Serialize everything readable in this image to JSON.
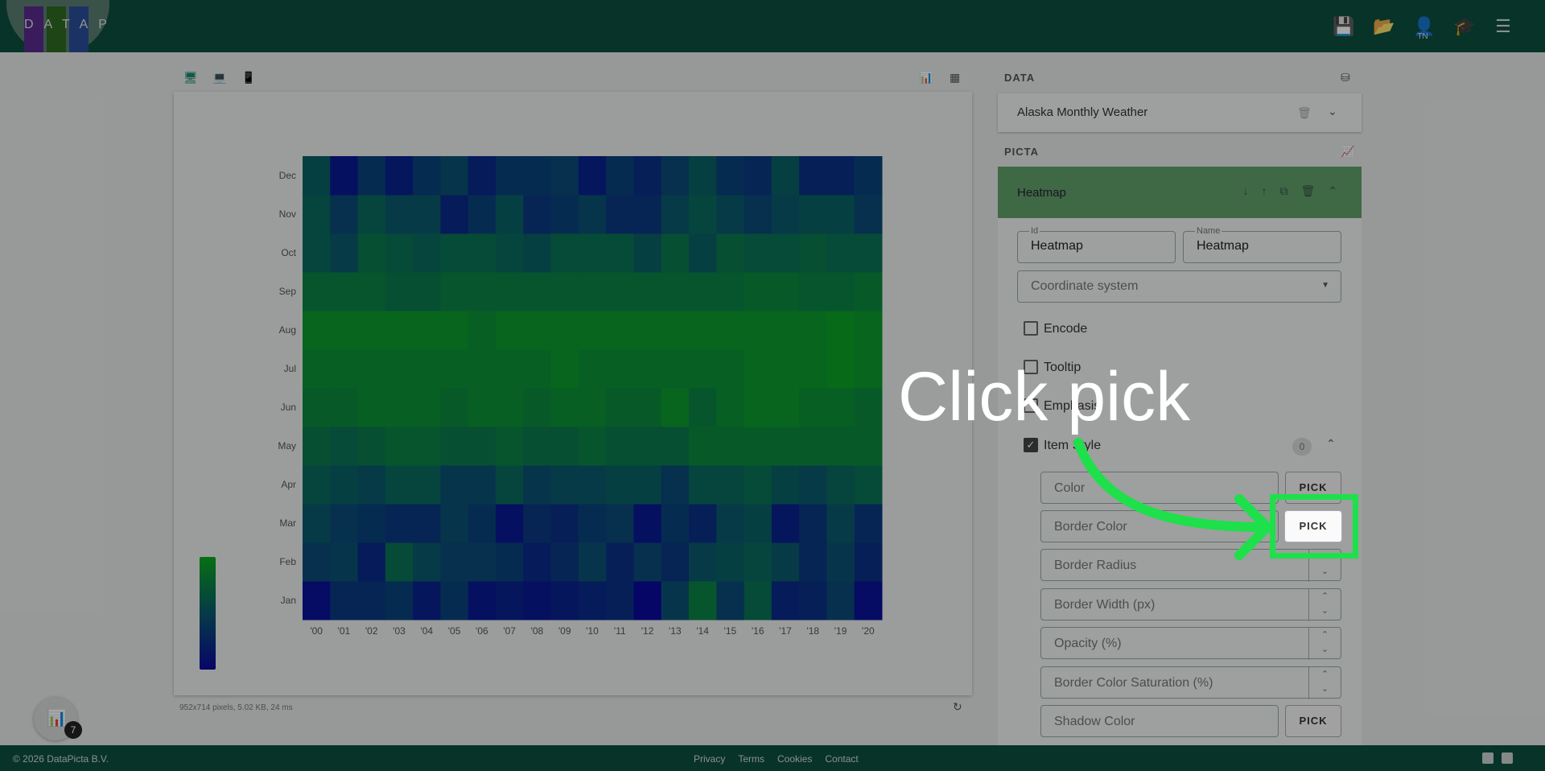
{
  "app": {
    "brand": "DATAPICTA"
  },
  "toolbar": {
    "icons": [
      "save-icon",
      "folder-open-icon",
      "user-icon",
      "school-icon",
      "menu-icon"
    ],
    "user_initials": "TN"
  },
  "preview": {
    "device_icons": [
      "desktop-icon",
      "laptop-icon",
      "phone-icon"
    ],
    "view_icons": [
      "chart-icon",
      "table-icon"
    ],
    "stats": "952x714 pixels, 5.02 KB, 24 ms"
  },
  "chart_data": {
    "type": "heatmap",
    "x_categories": [
      "'00",
      "'01",
      "'02",
      "'03",
      "'04",
      "'05",
      "'06",
      "'07",
      "'08",
      "'09",
      "'10",
      "'11",
      "'12",
      "'13",
      "'14",
      "'15",
      "'16",
      "'17",
      "'18",
      "'19",
      "'20"
    ],
    "y_categories": [
      "Jan",
      "Feb",
      "Mar",
      "Apr",
      "May",
      "Jun",
      "Jul",
      "Aug",
      "Sep",
      "Oct",
      "Nov",
      "Dec"
    ],
    "values": [
      [
        0.05,
        0.3,
        0.3,
        0.35,
        0.15,
        0.35,
        0.1,
        0.15,
        0.1,
        0.15,
        0.2,
        0.25,
        0.0,
        0.45,
        0.75,
        0.4,
        0.65,
        0.2,
        0.25,
        0.4,
        0.05
      ],
      [
        0.4,
        0.45,
        0.2,
        0.65,
        0.5,
        0.4,
        0.4,
        0.35,
        0.2,
        0.3,
        0.45,
        0.25,
        0.4,
        0.3,
        0.5,
        0.55,
        0.6,
        0.5,
        0.3,
        0.45,
        0.25
      ],
      [
        0.5,
        0.4,
        0.35,
        0.3,
        0.3,
        0.45,
        0.35,
        0.1,
        0.3,
        0.25,
        0.35,
        0.4,
        0.1,
        0.35,
        0.25,
        0.5,
        0.55,
        0.15,
        0.3,
        0.5,
        0.3
      ],
      [
        0.6,
        0.55,
        0.5,
        0.6,
        0.6,
        0.45,
        0.45,
        0.6,
        0.45,
        0.5,
        0.5,
        0.55,
        0.55,
        0.4,
        0.6,
        0.6,
        0.65,
        0.55,
        0.5,
        0.6,
        0.65
      ],
      [
        0.7,
        0.65,
        0.7,
        0.75,
        0.75,
        0.7,
        0.7,
        0.75,
        0.7,
        0.7,
        0.75,
        0.7,
        0.7,
        0.7,
        0.8,
        0.8,
        0.8,
        0.8,
        0.8,
        0.8,
        0.8
      ],
      [
        0.8,
        0.8,
        0.85,
        0.85,
        0.85,
        0.8,
        0.85,
        0.85,
        0.8,
        0.85,
        0.85,
        0.8,
        0.8,
        0.9,
        0.75,
        0.85,
        0.9,
        0.9,
        0.85,
        0.85,
        0.8
      ],
      [
        0.85,
        0.85,
        0.85,
        0.85,
        0.85,
        0.85,
        0.85,
        0.85,
        0.85,
        0.9,
        0.85,
        0.85,
        0.85,
        0.85,
        0.85,
        0.85,
        0.9,
        0.9,
        0.9,
        0.95,
        0.9
      ],
      [
        0.9,
        0.9,
        0.9,
        0.9,
        0.9,
        0.9,
        0.85,
        0.9,
        0.9,
        0.9,
        0.9,
        0.9,
        0.9,
        0.9,
        0.9,
        0.9,
        0.9,
        0.9,
        0.9,
        0.95,
        0.9
      ],
      [
        0.75,
        0.75,
        0.75,
        0.7,
        0.7,
        0.75,
        0.75,
        0.75,
        0.75,
        0.75,
        0.75,
        0.75,
        0.75,
        0.75,
        0.75,
        0.75,
        0.8,
        0.8,
        0.75,
        0.75,
        0.8
      ],
      [
        0.6,
        0.5,
        0.7,
        0.65,
        0.6,
        0.65,
        0.65,
        0.6,
        0.55,
        0.65,
        0.65,
        0.65,
        0.55,
        0.7,
        0.55,
        0.7,
        0.65,
        0.65,
        0.7,
        0.65,
        0.65
      ],
      [
        0.6,
        0.4,
        0.6,
        0.5,
        0.5,
        0.2,
        0.35,
        0.55,
        0.3,
        0.35,
        0.45,
        0.3,
        0.3,
        0.5,
        0.6,
        0.5,
        0.4,
        0.5,
        0.55,
        0.55,
        0.4
      ],
      [
        0.55,
        0.1,
        0.35,
        0.15,
        0.35,
        0.45,
        0.2,
        0.35,
        0.35,
        0.4,
        0.15,
        0.35,
        0.25,
        0.4,
        0.55,
        0.35,
        0.3,
        0.55,
        0.25,
        0.25,
        0.35
      ]
    ],
    "visual_map": {
      "min_color": "#0a0a9e",
      "max_color": "#0bab1e"
    }
  },
  "data_panel": {
    "title": "DATA",
    "dataset_name": "Alaska Monthly Weather"
  },
  "picta_panel": {
    "title": "PICTA",
    "component_name": "Heatmap",
    "id_label": "Id",
    "id_value": "Heatmap",
    "name_label": "Name",
    "name_value": "Heatmap",
    "coordinate_placeholder": "Coordinate system",
    "options": {
      "encode": "Encode",
      "tooltip": "Tooltip",
      "emphasis": "Emphasis",
      "item_style": "Item Style"
    },
    "item_style_count": "0",
    "fields": {
      "color": "Color",
      "border_color": "Border Color",
      "border_radius": "Border Radius",
      "border_width": "Border Width (px)",
      "opacity": "Opacity (%)",
      "border_color_saturation": "Border Color Saturation (%)",
      "shadow_color": "Shadow Color"
    },
    "pick_label": "PICK"
  },
  "overlay": {
    "caption": "Click pick",
    "highlight_color": "#1ee04a"
  },
  "fab": {
    "badge": "7"
  },
  "footer": {
    "copyright": "© 2026 DataPicta B.V.",
    "links": [
      "Privacy",
      "Terms",
      "Cookies",
      "Contact"
    ]
  }
}
